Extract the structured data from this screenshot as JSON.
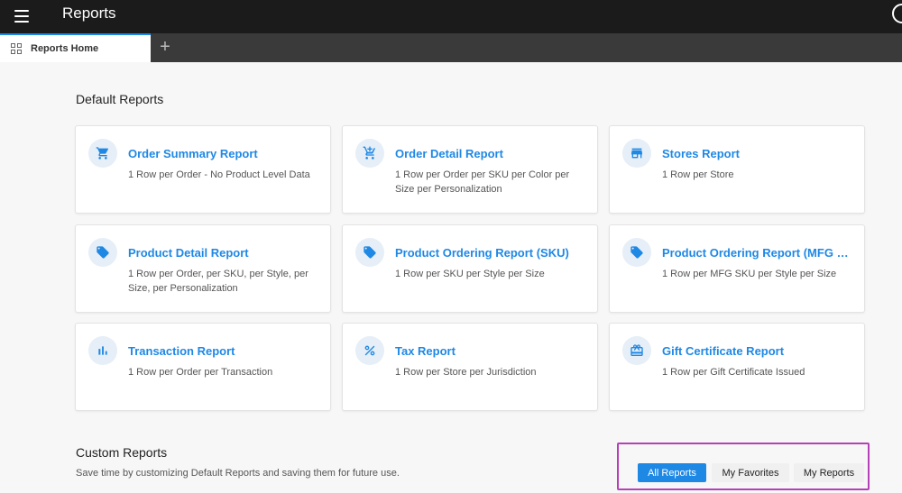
{
  "app": {
    "title": "Reports"
  },
  "tabs": [
    {
      "label": "Reports Home"
    }
  ],
  "default_reports": {
    "heading": "Default Reports",
    "cards": [
      {
        "title": "Order Summary Report",
        "desc": "1 Row per Order - No Product Level Data",
        "icon": "shopping-cart-icon"
      },
      {
        "title": "Order Detail Report",
        "desc": "1 Row per Order per SKU per Color per Size per Personalization",
        "icon": "add-cart-icon"
      },
      {
        "title": "Stores Report",
        "desc": "1 Row per Store",
        "icon": "store-icon"
      },
      {
        "title": "Product Detail Report",
        "desc": "1 Row per Order, per SKU, per Style, per Size, per Personalization",
        "icon": "tag-icon"
      },
      {
        "title": "Product Ordering Report (SKU)",
        "desc": "1 Row per SKU per Style per Size",
        "icon": "tag-icon"
      },
      {
        "title": "Product Ordering Report (MFG SK...",
        "desc": "1 Row per MFG SKU per Style per Size",
        "icon": "tag-icon"
      },
      {
        "title": "Transaction Report",
        "desc": "1 Row per Order per Transaction",
        "icon": "bar-chart-icon"
      },
      {
        "title": "Tax Report",
        "desc": "1 Row per Store per Jurisdiction",
        "icon": "percent-icon"
      },
      {
        "title": "Gift Certificate Report",
        "desc": "1 Row per Gift Certificate Issued",
        "icon": "gift-card-icon"
      }
    ]
  },
  "custom_reports": {
    "heading": "Custom Reports",
    "desc": "Save time by customizing Default Reports and saving them for future use.",
    "filters": [
      {
        "label": "All Reports",
        "active": true
      },
      {
        "label": "My Favorites",
        "active": false
      },
      {
        "label": "My Reports",
        "active": false
      }
    ]
  },
  "colors": {
    "accent": "#1e88e5",
    "topbar": "#1b1b1b",
    "tabbar": "#3a3a3a",
    "highlight": "#b640b8",
    "icon_bg": "#e6eef7"
  }
}
